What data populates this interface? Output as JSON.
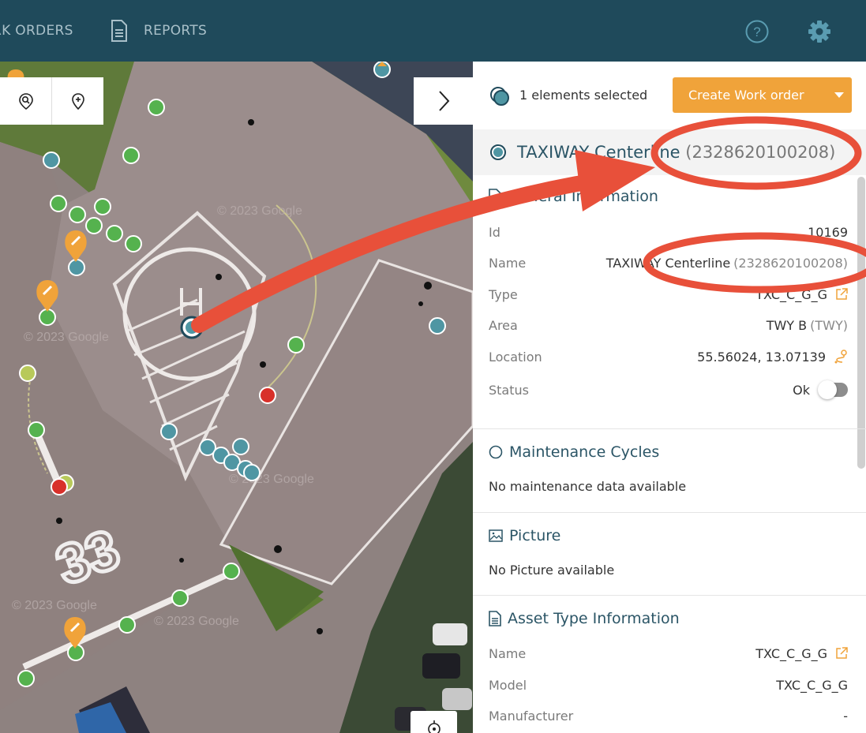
{
  "nav": {
    "work_orders": "RK ORDERS",
    "reports": "REPORTS"
  },
  "icons": {
    "help": "help-circle-icon",
    "settings": "gear-icon",
    "zoom": "zoom-pin-icon",
    "pin": "map-pin-icon",
    "collapse": "chevron-right-icon",
    "locate": "crosshair-icon"
  },
  "colors": {
    "topbar": "#1f4a5b",
    "accent": "#f0a33a",
    "teal": "#2b5566",
    "annotation": "#e8503a"
  },
  "selection": {
    "text": "1 elements selected",
    "create_button": "Create Work order"
  },
  "asset": {
    "title": "TAXIWAY Centerline",
    "code": "(2328620100208)"
  },
  "general": {
    "title": "General Information",
    "rows": [
      {
        "label": "Id",
        "value": "10169",
        "extra": ""
      },
      {
        "label": "Name",
        "value": "TAXIWAY Centerline",
        "extra": "(2328620100208)"
      },
      {
        "label": "Type",
        "value": "TXC_C_G_G",
        "extra": ""
      },
      {
        "label": "Area",
        "value": "TWY B",
        "extra": "(TWY)"
      },
      {
        "label": "Location",
        "value": "55.56024, 13.07139",
        "extra": ""
      },
      {
        "label": "Status",
        "value": "Ok",
        "extra": ""
      }
    ]
  },
  "maintenance": {
    "title": "Maintenance Cycles",
    "note": "No maintenance data available"
  },
  "picture": {
    "title": "Picture",
    "note": "No Picture available"
  },
  "asset_type": {
    "title": "Asset Type Information",
    "rows": [
      {
        "label": "Name",
        "value": "TXC_C_G_G"
      },
      {
        "label": "Model",
        "value": "TXC_C_G_G"
      },
      {
        "label": "Manufacturer",
        "value": "-"
      }
    ]
  },
  "map": {
    "marker_number": "33",
    "watermarks": [
      "© 2023 Google",
      "© 2023 Google",
      "© 2023 Google",
      "© 2023 Google",
      "© 2023 Google"
    ]
  }
}
